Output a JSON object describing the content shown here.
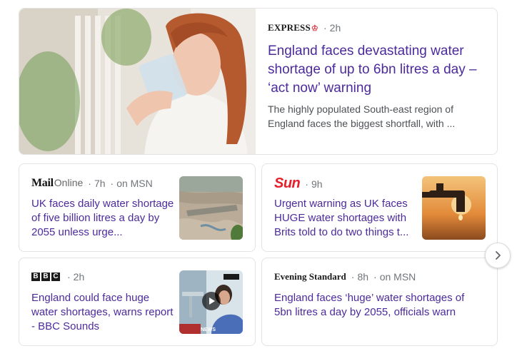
{
  "featured": {
    "source": "EXPRESS",
    "time": "2h",
    "headline": "England faces devastating water shortage of up to 6bn litres a day – ‘act now’ warning",
    "snippet": "The highly populated South-east region of England faces the biggest shortfall, with ..."
  },
  "cards": [
    {
      "source_main": "Mail",
      "source_suffix": "Online",
      "time": "7h",
      "platform": "on MSN",
      "headline": "UK faces daily water shortage of five billion litres a day by 2055 unless urge..."
    },
    {
      "source": "Sun",
      "time": "9h",
      "headline": "Urgent warning as UK faces HUGE water shortages with Brits told to do two things t..."
    },
    {
      "source_letters": [
        "B",
        "B",
        "C"
      ],
      "time": "2h",
      "headline": "England could face huge water shortages, warns report - BBC Sounds",
      "thumb_badge": "NEWS"
    },
    {
      "source": "Evening Standard",
      "time": "8h",
      "platform": "on MSN",
      "headline": "England faces ‘huge’ water shortages of 5bn litres a day by 2055, officials warn"
    }
  ],
  "icons": {
    "next": "chevron-right-icon",
    "play": "play-icon"
  },
  "colors": {
    "headline": "#4c2a9c",
    "meta": "#70757a",
    "sun_red": "#e5202a"
  }
}
